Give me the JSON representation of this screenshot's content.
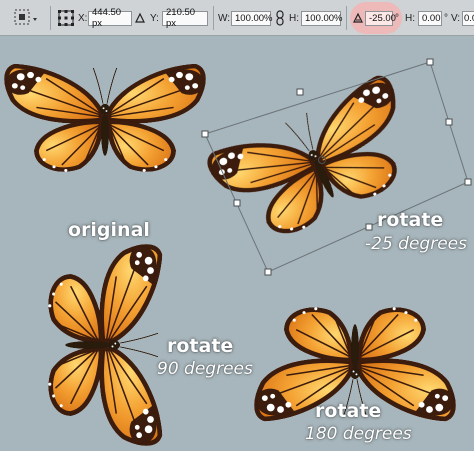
{
  "options_bar": {
    "x_label": "X:",
    "x_value": "444.50 px",
    "y_value": "210.50 px",
    "w_label": "W:",
    "w_value": "100.00%",
    "h_label": "H:",
    "h_value": "100.00%",
    "angle_value": "-25.00",
    "angle_unit": "°",
    "skew_h_label": "H:",
    "skew_h_value": "0.00",
    "skew_unit": "°",
    "skew_v_label": "V:",
    "skew_v_value": "0.0"
  },
  "captions": {
    "original": "original",
    "rotate_25_title": "rotate",
    "rotate_25_sub": "-25 degrees",
    "rotate_90_title": "rotate",
    "rotate_90_sub": "90 degrees",
    "rotate_180_title": "rotate",
    "rotate_180_sub": "180 degrees"
  },
  "colors": {
    "canvas": "#a7b6bc",
    "wing_orange": "#ec8a1c",
    "wing_dark": "#3a1a0c",
    "highlight": "#f2b4b4"
  }
}
